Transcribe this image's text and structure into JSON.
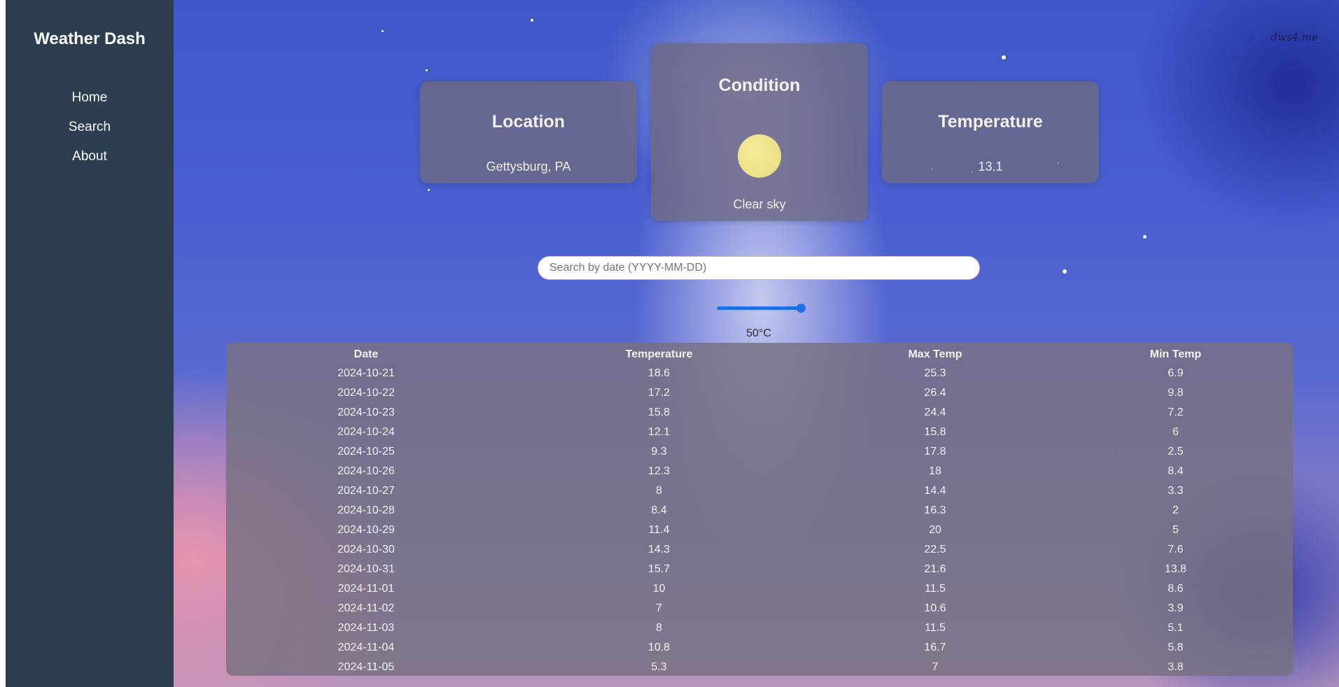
{
  "app": {
    "brand": "Weather Dash",
    "nav": [
      "Home",
      "Search",
      "About"
    ]
  },
  "watermark": "dws4.me",
  "cards": {
    "location": {
      "title": "Location",
      "value": "Gettysburg, PA"
    },
    "condition": {
      "title": "Condition",
      "value": "Clear sky",
      "icon": "sun-icon"
    },
    "temperature": {
      "title": "Temperature",
      "value": "13.1"
    }
  },
  "search": {
    "placeholder": "Search by date (YYYY-MM-DD)",
    "value": ""
  },
  "slider": {
    "label": "50°C",
    "value": 50,
    "fill_fraction": 1.0,
    "accent_color": "#1f6fe5"
  },
  "table": {
    "headers": [
      "Date",
      "Temperature",
      "Max Temp",
      "Min Temp"
    ],
    "rows": [
      [
        "2024-10-21",
        "18.6",
        "25.3",
        "6.9"
      ],
      [
        "2024-10-22",
        "17.2",
        "26.4",
        "9.8"
      ],
      [
        "2024-10-23",
        "15.8",
        "24.4",
        "7.2"
      ],
      [
        "2024-10-24",
        "12.1",
        "15.8",
        "6"
      ],
      [
        "2024-10-25",
        "9.3",
        "17.8",
        "2.5"
      ],
      [
        "2024-10-26",
        "12.3",
        "18",
        "8.4"
      ],
      [
        "2024-10-27",
        "8",
        "14.4",
        "3.3"
      ],
      [
        "2024-10-28",
        "8.4",
        "16.3",
        "2"
      ],
      [
        "2024-10-29",
        "11.4",
        "20",
        "5"
      ],
      [
        "2024-10-30",
        "14.3",
        "22.5",
        "7.6"
      ],
      [
        "2024-10-31",
        "15.7",
        "21.6",
        "13.8"
      ],
      [
        "2024-11-01",
        "10",
        "11.5",
        "8.6"
      ],
      [
        "2024-11-02",
        "7",
        "10.6",
        "3.9"
      ],
      [
        "2024-11-03",
        "8",
        "11.5",
        "5.1"
      ],
      [
        "2024-11-04",
        "10.8",
        "16.7",
        "5.8"
      ],
      [
        "2024-11-05",
        "5.3",
        "7",
        "3.8"
      ]
    ]
  },
  "colors": {
    "sidebar": "#2c3e50",
    "card": "#6e6982",
    "sun": "#f3ec9a"
  }
}
